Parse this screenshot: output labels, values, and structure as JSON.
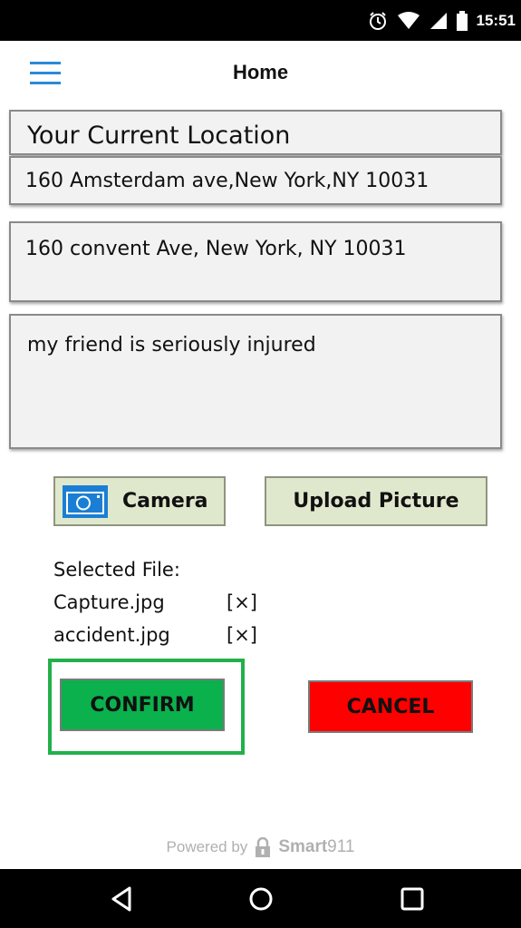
{
  "status_bar": {
    "time": "15:51"
  },
  "header": {
    "title": "Home"
  },
  "form": {
    "location_label": "Your Current Location",
    "location_value": "160 Amsterdam ave,New York,NY 10031",
    "destination_value": "160 convent Ave, New York, NY 10031",
    "description_value": "my friend is seriously injured"
  },
  "buttons": {
    "camera": "Camera",
    "upload": "Upload Picture",
    "confirm": "CONFIRM",
    "cancel": "CANCEL"
  },
  "files": {
    "label": "Selected File:",
    "items": [
      {
        "name": "Capture.jpg",
        "remove": "[×]"
      },
      {
        "name": "accident.jpg",
        "remove": "[×]"
      }
    ]
  },
  "footer": {
    "powered_by": "Powered by",
    "brand": "Smart",
    "brand_suffix": "911"
  },
  "colors": {
    "confirm": "#0bb14c",
    "cancel": "#ff0000",
    "secondary_button": "#dfe8cc",
    "highlight_outline": "#22b04a",
    "menu_icon": "#2a8ad8"
  }
}
